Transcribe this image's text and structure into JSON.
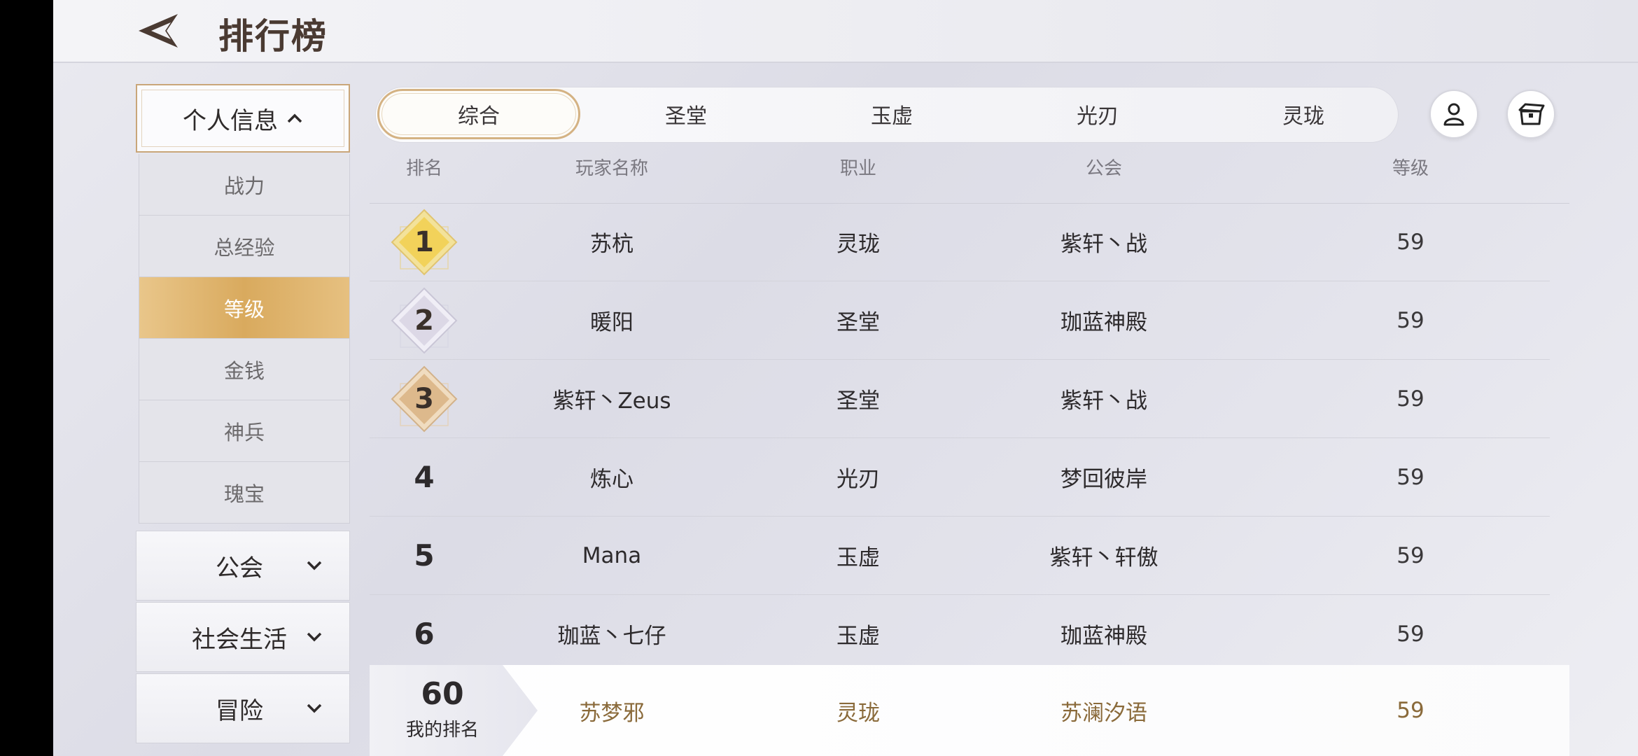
{
  "header": {
    "title": "排行榜"
  },
  "sidebar": {
    "expanded_category": "个人信息",
    "sub_items": [
      "战力",
      "总经验",
      "等级",
      "金钱",
      "神兵",
      "瑰宝"
    ],
    "active_sub_item": "等级",
    "collapsed_categories": [
      "公会",
      "社会生活",
      "冒险"
    ]
  },
  "tabs": [
    "综合",
    "圣堂",
    "玉虚",
    "光刃",
    "灵珑"
  ],
  "active_tab": "综合",
  "icons": {
    "profile": "user-icon",
    "chest": "treasure-chest-icon",
    "back": "back-arrow-icon"
  },
  "colors": {
    "gold_accent": "#d9aa5e",
    "my_row_text": "#8a6a3a"
  },
  "table": {
    "headers": {
      "rank": "排名",
      "name": "玩家名称",
      "job": "职业",
      "guild": "公会",
      "level": "等级"
    },
    "rows": [
      {
        "rank": "1",
        "name": "苏杭",
        "job": "灵珑",
        "guild": "紫轩丶战",
        "level": "59"
      },
      {
        "rank": "2",
        "name": "暖阳",
        "job": "圣堂",
        "guild": "珈蓝神殿",
        "level": "59"
      },
      {
        "rank": "3",
        "name": "紫轩丶Zeus",
        "job": "圣堂",
        "guild": "紫轩丶战",
        "level": "59"
      },
      {
        "rank": "4",
        "name": "炼心",
        "job": "光刃",
        "guild": "梦回彼岸",
        "level": "59"
      },
      {
        "rank": "5",
        "name": "Mana",
        "job": "玉虚",
        "guild": "紫轩丶轩傲",
        "level": "59"
      },
      {
        "rank": "6",
        "name": "珈蓝丶七仔",
        "job": "玉虚",
        "guild": "珈蓝神殿",
        "level": "59"
      }
    ]
  },
  "my_rank": {
    "rank": "60",
    "label": "我的排名",
    "name": "苏梦邪",
    "job": "灵珑",
    "guild": "苏澜汐语",
    "level": "59"
  }
}
